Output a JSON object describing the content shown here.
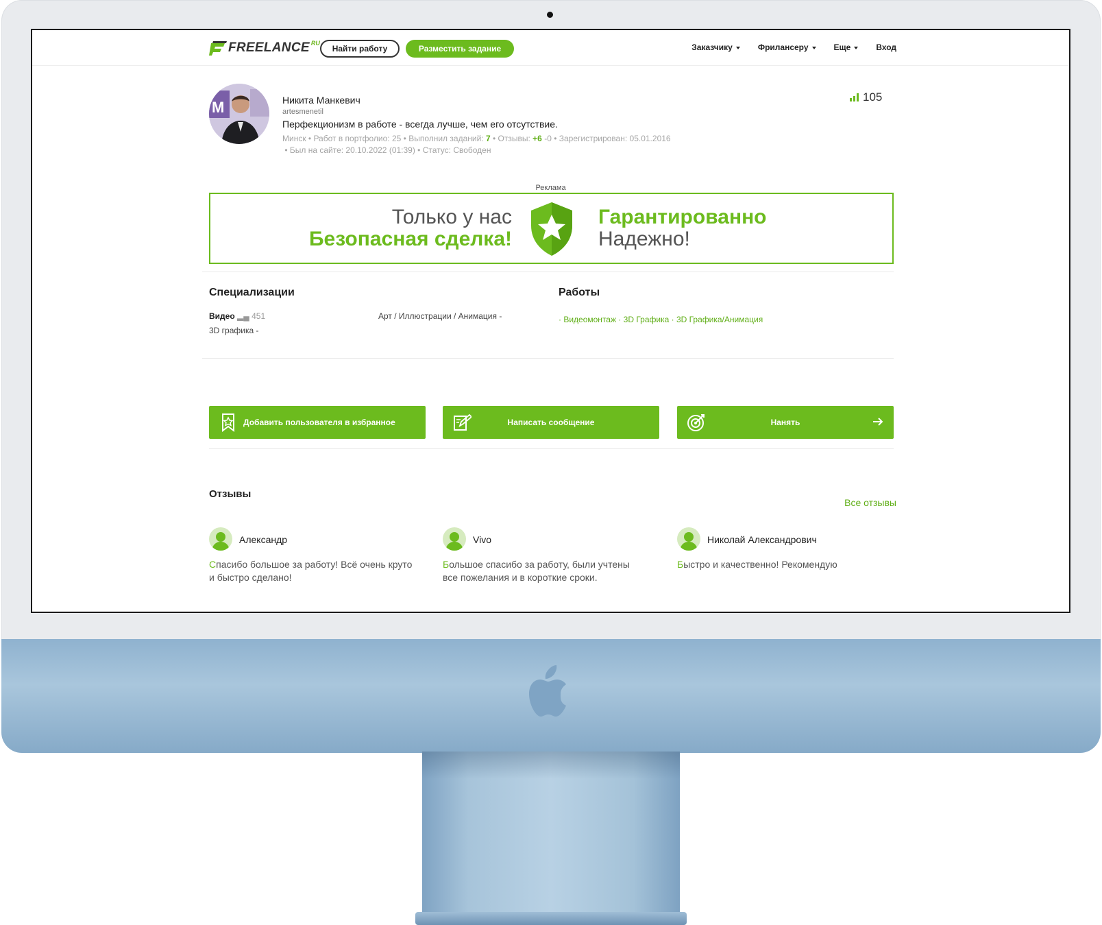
{
  "header": {
    "logo_text": "FREELANCE",
    "logo_suffix": "RU",
    "find_work": "Найти работу",
    "post_task": "Разместить задание",
    "nav": [
      "Заказчику",
      "Фрилансеру",
      "Еще",
      "Вход"
    ]
  },
  "profile": {
    "name": "Никита Манкевич",
    "login": "artesmenetil",
    "quote": "Перфекционизм в работе - всегда лучше, чем его отсутствие.",
    "meta": {
      "city": "Минск",
      "portfolio": "Работ в портфолио: 25",
      "completed_label": "Выполнил заданий:",
      "completed_value": "7",
      "reviews_label": "Отзывы:",
      "reviews_pos": "+6",
      "reviews_neg": "-0",
      "registered": "Зарегистрирован: 05.01.2016",
      "last_seen": "Был на сайте: 20.10.2022 (01:39)",
      "status": "Статус: Свободен"
    },
    "rating": "105"
  },
  "ad": {
    "label": "Реклама",
    "left_line1": "Только у нас",
    "left_line2": "Безопасная сделка!",
    "right_line1": "Гарантированно",
    "right_line2": "Надежно!"
  },
  "specializations": {
    "title": "Специализации",
    "items": [
      {
        "name": "Видео",
        "count": "451"
      },
      {
        "name": "3D графика -"
      },
      {
        "name": "Арт / Иллюстрации / Анимация -"
      }
    ]
  },
  "works": {
    "title": "Работы",
    "tags": "· Видеомонтаж · 3D Графика · 3D Графика/Анимация"
  },
  "actions": {
    "favorite": "Добавить пользователя в избранное",
    "message": "Написать сообщение",
    "hire": "Нанять"
  },
  "reviews": {
    "title": "Отзывы",
    "all_link": "Все отзывы",
    "items": [
      {
        "author": "Александр",
        "text_first": "С",
        "text_rest": "пасибо большое за работу! Всё очень круто и быстро сделано!"
      },
      {
        "author": "Vivo",
        "text_first": "Б",
        "text_rest": "ольшое спасибо за работу, были учтены все пожелания и в короткие сроки."
      },
      {
        "author": "Николай Александрович",
        "text_first": "Б",
        "text_rest": "ыстро и качественно! Рекомендую"
      }
    ]
  },
  "colors": {
    "accent": "#6cbb1e",
    "chin": "#9bbcd6",
    "bezel": "#e9ebee"
  }
}
